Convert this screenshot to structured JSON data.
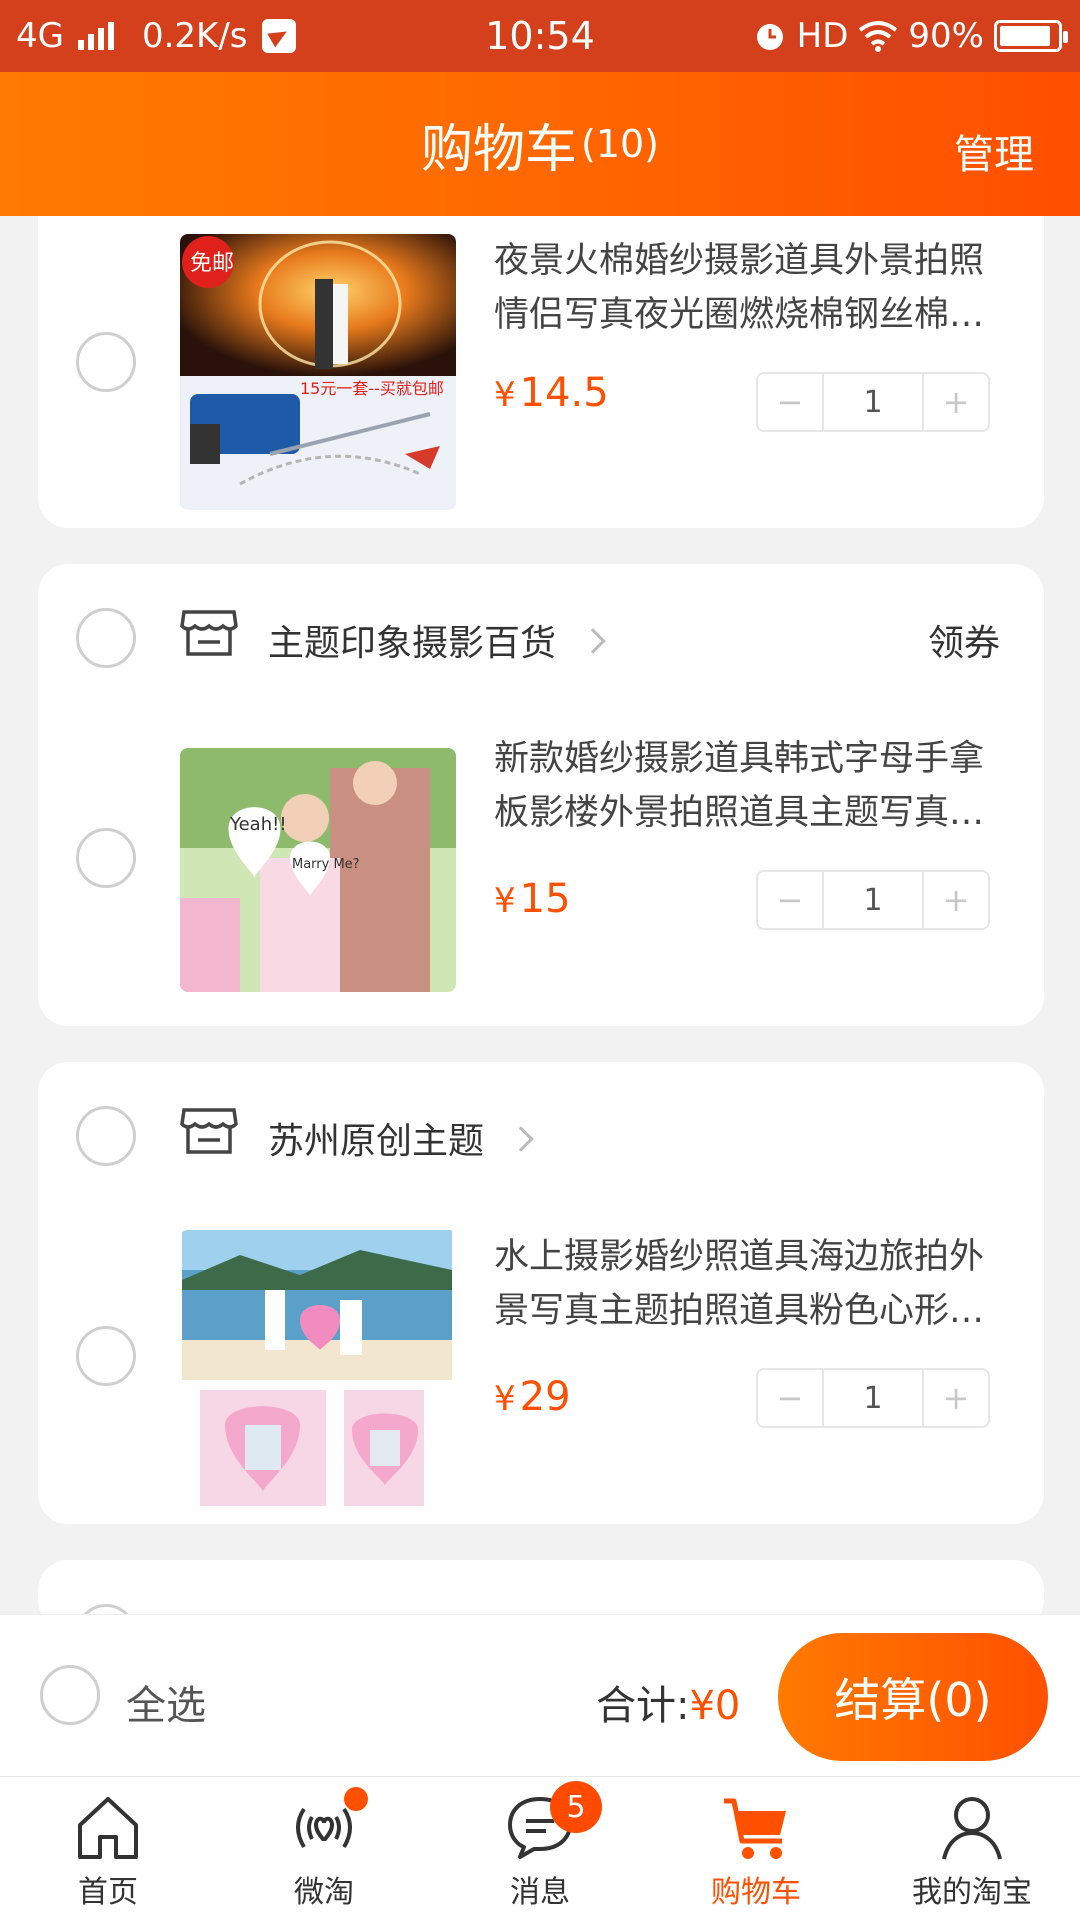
{
  "status_bar": {
    "network": "4G",
    "speed": "0.2K/s",
    "time": "10:54",
    "hd": "HD",
    "battery": "90%"
  },
  "header": {
    "title": "购物车",
    "count": "(10)",
    "manage": "管理"
  },
  "items": [
    {
      "title": "夜景火棉婚纱摄影道具外景拍照情侣写真夜光圈燃烧棉钢丝棉…",
      "price_symbol": "¥",
      "price": "14.5",
      "quantity": "1",
      "badge": "免邮",
      "promo_text": "15元一套--买就包邮"
    },
    {
      "shop": "主题印象摄影百货",
      "coupon": "领券",
      "title": "新款婚纱摄影道具韩式字母手拿板影楼外景拍照道具主题写真…",
      "price_symbol": "¥",
      "price": "15",
      "quantity": "1",
      "sign_text_1": "Yeah!!",
      "sign_text_2": "Marry Me?"
    },
    {
      "shop": "苏州原创主题",
      "title": "水上摄影婚纱照道具海边旅拍外景写真主题拍照道具粉色心形…",
      "price_symbol": "¥",
      "price": "29",
      "quantity": "1"
    }
  ],
  "checkout": {
    "select_all": "全选",
    "total_label": "合计:",
    "total_amount": "¥0",
    "button": "结算(0)"
  },
  "tabs": [
    {
      "label": "首页",
      "icon": "home-icon"
    },
    {
      "label": "微淘",
      "icon": "weitao-icon"
    },
    {
      "label": "消息",
      "icon": "message-icon",
      "badge": "5"
    },
    {
      "label": "购物车",
      "icon": "cart-icon"
    },
    {
      "label": "我的淘宝",
      "icon": "user-icon"
    }
  ],
  "colors": {
    "accent": "#ff5000",
    "header_start": "#ff7a00",
    "header_end": "#ff4f00",
    "status_bar": "#d4401c"
  }
}
